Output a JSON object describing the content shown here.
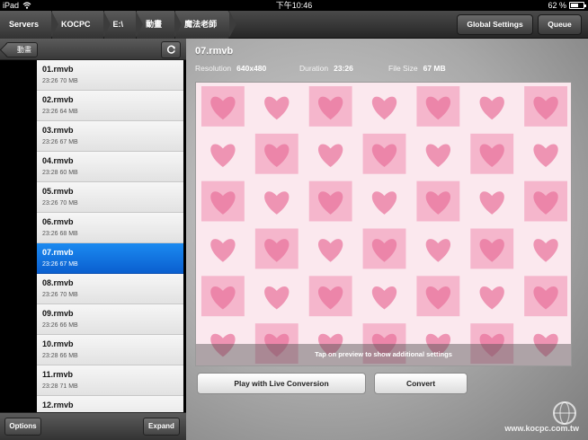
{
  "status_bar": {
    "carrier": "iPad",
    "time": "下午10:46",
    "battery_pct": "62 %",
    "battery_level": 0.62
  },
  "toolbar": {
    "breadcrumbs": [
      "Servers",
      "KOCPC",
      "E:\\",
      "動畫",
      "魔法老師"
    ],
    "global_settings_label": "Global Settings",
    "queue_label": "Queue"
  },
  "sidebar": {
    "back_label": "動畫",
    "refresh_icon": "refresh-icon",
    "files": [
      {
        "name": "01.rmvb",
        "duration": "23:26",
        "size": "70 MB"
      },
      {
        "name": "02.rmvb",
        "duration": "23:26",
        "size": "64 MB"
      },
      {
        "name": "03.rmvb",
        "duration": "23:26",
        "size": "67 MB"
      },
      {
        "name": "04.rmvb",
        "duration": "23:28",
        "size": "60 MB"
      },
      {
        "name": "05.rmvb",
        "duration": "23:26",
        "size": "70 MB"
      },
      {
        "name": "06.rmvb",
        "duration": "23:26",
        "size": "68 MB"
      },
      {
        "name": "07.rmvb",
        "duration": "23:26",
        "size": "67 MB",
        "selected": true
      },
      {
        "name": "08.rmvb",
        "duration": "23:26",
        "size": "70 MB"
      },
      {
        "name": "09.rmvb",
        "duration": "23:26",
        "size": "66 MB"
      },
      {
        "name": "10.rmvb",
        "duration": "23:28",
        "size": "66 MB"
      },
      {
        "name": "11.rmvb",
        "duration": "23:28",
        "size": "71 MB"
      },
      {
        "name": "12.rmvb",
        "duration": "",
        "size": ""
      }
    ],
    "options_label": "Options",
    "expand_label": "Expand"
  },
  "detail": {
    "title": "07.rmvb",
    "resolution_label": "Resolution",
    "resolution_value": "640x480",
    "duration_label": "Duration",
    "duration_value": "23:26",
    "filesize_label": "File Size",
    "filesize_value": "67 MB",
    "preview_caption": "Tap on preview to show additional settings",
    "play_label": "Play with Live Conversion",
    "convert_label": "Convert"
  },
  "watermark": {
    "text": "www.kocpc.com.tw"
  },
  "colors": {
    "selection": "#1b8af0",
    "preview_pink": "#f08cb0"
  }
}
